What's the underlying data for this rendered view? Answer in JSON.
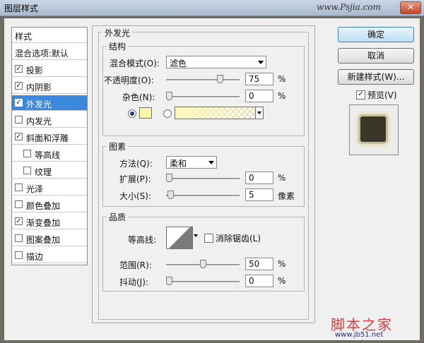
{
  "window": {
    "title": "图层样式",
    "watermark_url": "www.Psjia.com",
    "close_glyph": "✕"
  },
  "styles_list": [
    {
      "label": "样式",
      "type": "header"
    },
    {
      "label": "混合选项:默认",
      "type": "header"
    },
    {
      "label": "投影",
      "checked": true
    },
    {
      "label": "内阴影",
      "checked": true
    },
    {
      "label": "外发光",
      "checked": true,
      "selected": true
    },
    {
      "label": "内发光",
      "checked": false
    },
    {
      "label": "斜面和浮雕",
      "checked": true
    },
    {
      "label": "等高线",
      "checked": false,
      "sub": true
    },
    {
      "label": "纹理",
      "checked": false,
      "sub": true
    },
    {
      "label": "光泽",
      "checked": false
    },
    {
      "label": "颜色叠加",
      "checked": false
    },
    {
      "label": "渐变叠加",
      "checked": true
    },
    {
      "label": "图案叠加",
      "checked": false
    },
    {
      "label": "描边",
      "checked": false
    }
  ],
  "panel": {
    "title": "外发光",
    "structure": {
      "title": "结构",
      "blend_mode_label": "混合模式(O):",
      "blend_mode_value": "滤色",
      "opacity_label": "不透明度(O):",
      "opacity_value": "75",
      "opacity_fraction": 0.75,
      "noise_label": "杂色(N):",
      "noise_value": "0",
      "noise_fraction": 0,
      "percent": "%"
    },
    "elements": {
      "title": "图素",
      "method_label": "方法(Q):",
      "method_value": "柔和",
      "spread_label": "扩展(P):",
      "spread_value": "0",
      "spread_fraction": 0,
      "size_label": "大小(S):",
      "size_value": "5",
      "size_fraction": 0.02,
      "percent": "%",
      "size_unit": "像素"
    },
    "quality": {
      "title": "品质",
      "contour_label": "等高线:",
      "antialias_label": "消除锯齿(L)",
      "antialias_checked": false,
      "range_label": "范围(R):",
      "range_value": "50",
      "range_fraction": 0.5,
      "jitter_label": "抖动(J):",
      "jitter_value": "0",
      "jitter_fraction": 0,
      "percent": "%"
    }
  },
  "buttons": {
    "ok": "确定",
    "cancel": "取消",
    "new_style": "新建样式(W)..."
  },
  "preview": {
    "label": "预览(V)",
    "checked": true
  },
  "colors": {
    "glow": "#fff7a8",
    "selection": "#3c88dc",
    "watermark_red": "#d64040"
  },
  "site_watermark": {
    "brand": "脚本之家",
    "url": "www.jb51.net"
  }
}
